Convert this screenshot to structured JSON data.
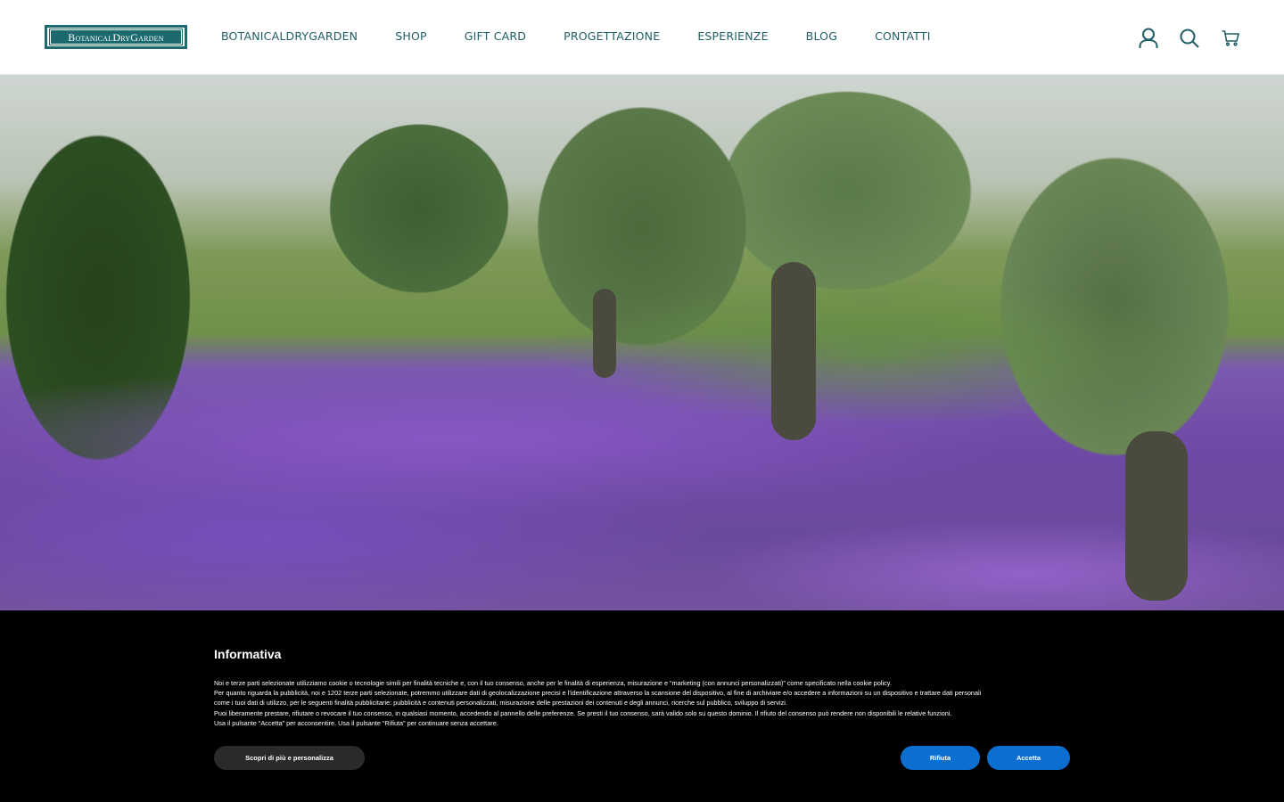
{
  "header": {
    "logo_text": "BotanicalDryGarden",
    "nav": [
      {
        "label": "BOTANICALDRYGARDEN"
      },
      {
        "label": "SHOP"
      },
      {
        "label": "GIFT CARD"
      },
      {
        "label": "PROGETTAZIONE"
      },
      {
        "label": "ESPERIENZE"
      },
      {
        "label": "BLOG"
      },
      {
        "label": "CONTATTI"
      }
    ],
    "icons": [
      "user-icon",
      "search-icon",
      "cart-icon"
    ]
  },
  "colors": {
    "brand": "#1d6a6e",
    "nav_text": "#1f5e66",
    "banner_bg": "#000000",
    "button_primary": "#0a6fd1"
  },
  "cookie_banner": {
    "title": "Informativa",
    "lines": [
      "Noi e terze parti selezionate utilizziamo cookie o tecnologie simili per finalità tecniche e, con il tuo consenso, anche per le finalità di esperienza, misurazione e “marketing (con annunci personalizzati)” come specificato nella cookie policy.",
      "Per quanto riguarda la pubblicità, noi e 1202 terze parti selezionate, potremmo utilizzare dati di geolocalizzazione precisi e l’identificazione attraverso la scansione del dispositivo, al fine di archiviare e/o accedere a informazioni su un dispositivo e trattare dati personali",
      "come i tuoi dati di utilizzo, per le seguenti finalità pubblicitarie: pubblicità e contenuti personalizzati, misurazione delle prestazioni dei contenuti e degli annunci, ricerche sul pubblico, sviluppo di servizi.",
      "Puoi liberamente prestare, rifiutare o revocare il tuo consenso, in qualsiasi momento, accedendo al pannello delle preferenze. Se presti il tuo consenso, sarà valido solo su questo dominio. Il rifiuto del consenso può rendere non disponibili le relative funzioni.",
      "Usa il pulsante “Accetta” per acconsentire. Usa il pulsante “Rifiuta” per continuare senza accettare."
    ],
    "btn_more": "Scopri di più e personalizza",
    "btn_reject": "Rifiuta",
    "btn_accept": "Accetta"
  }
}
